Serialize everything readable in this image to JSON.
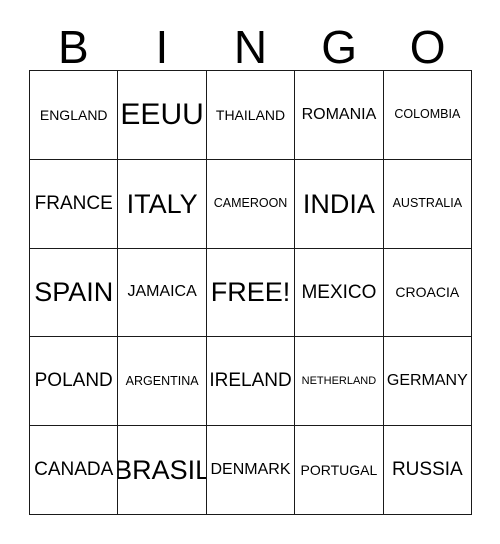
{
  "card": {
    "title": "BINGO",
    "header": {
      "letters": [
        "B",
        "I",
        "N",
        "G",
        "O"
      ]
    },
    "colors": {
      "background": "#ffffff",
      "border": "#1a1a1a",
      "text": "#000000"
    },
    "grid": {
      "rows": 5,
      "columns": 5,
      "free_space": {
        "row": 2,
        "column": 2,
        "label": "FREE!"
      },
      "cells": [
        [
          {
            "label": "ENGLAND",
            "size": "md"
          },
          {
            "label": "EEUU",
            "size": "3xl"
          },
          {
            "label": "THAILAND",
            "size": "md"
          },
          {
            "label": "ROMANIA",
            "size": "lg"
          },
          {
            "label": "COLOMBIA",
            "size": "sm"
          }
        ],
        [
          {
            "label": "FRANCE",
            "size": "xl"
          },
          {
            "label": "ITALY",
            "size": "2xl"
          },
          {
            "label": "CAMEROON",
            "size": "sm"
          },
          {
            "label": "INDIA",
            "size": "2xl"
          },
          {
            "label": "AUSTRALIA",
            "size": "sm"
          }
        ],
        [
          {
            "label": "SPAIN",
            "size": "2xl"
          },
          {
            "label": "JAMAICA",
            "size": "lg"
          },
          {
            "label": "FREE!",
            "size": "2xl"
          },
          {
            "label": "MEXICO",
            "size": "xl"
          },
          {
            "label": "CROACIA",
            "size": "md"
          }
        ],
        [
          {
            "label": "POLAND",
            "size": "xl"
          },
          {
            "label": "ARGENTINA",
            "size": "sm"
          },
          {
            "label": "IRELAND",
            "size": "xl"
          },
          {
            "label": "NETHERLAND",
            "size": "xs"
          },
          {
            "label": "GERMANY",
            "size": "lg"
          }
        ],
        [
          {
            "label": "CANADA",
            "size": "xl"
          },
          {
            "label": "BRASIL",
            "size": "2xl"
          },
          {
            "label": "DENMARK",
            "size": "lg"
          },
          {
            "label": "PORTUGAL",
            "size": "md"
          },
          {
            "label": "RUSSIA",
            "size": "xl"
          }
        ]
      ]
    }
  }
}
